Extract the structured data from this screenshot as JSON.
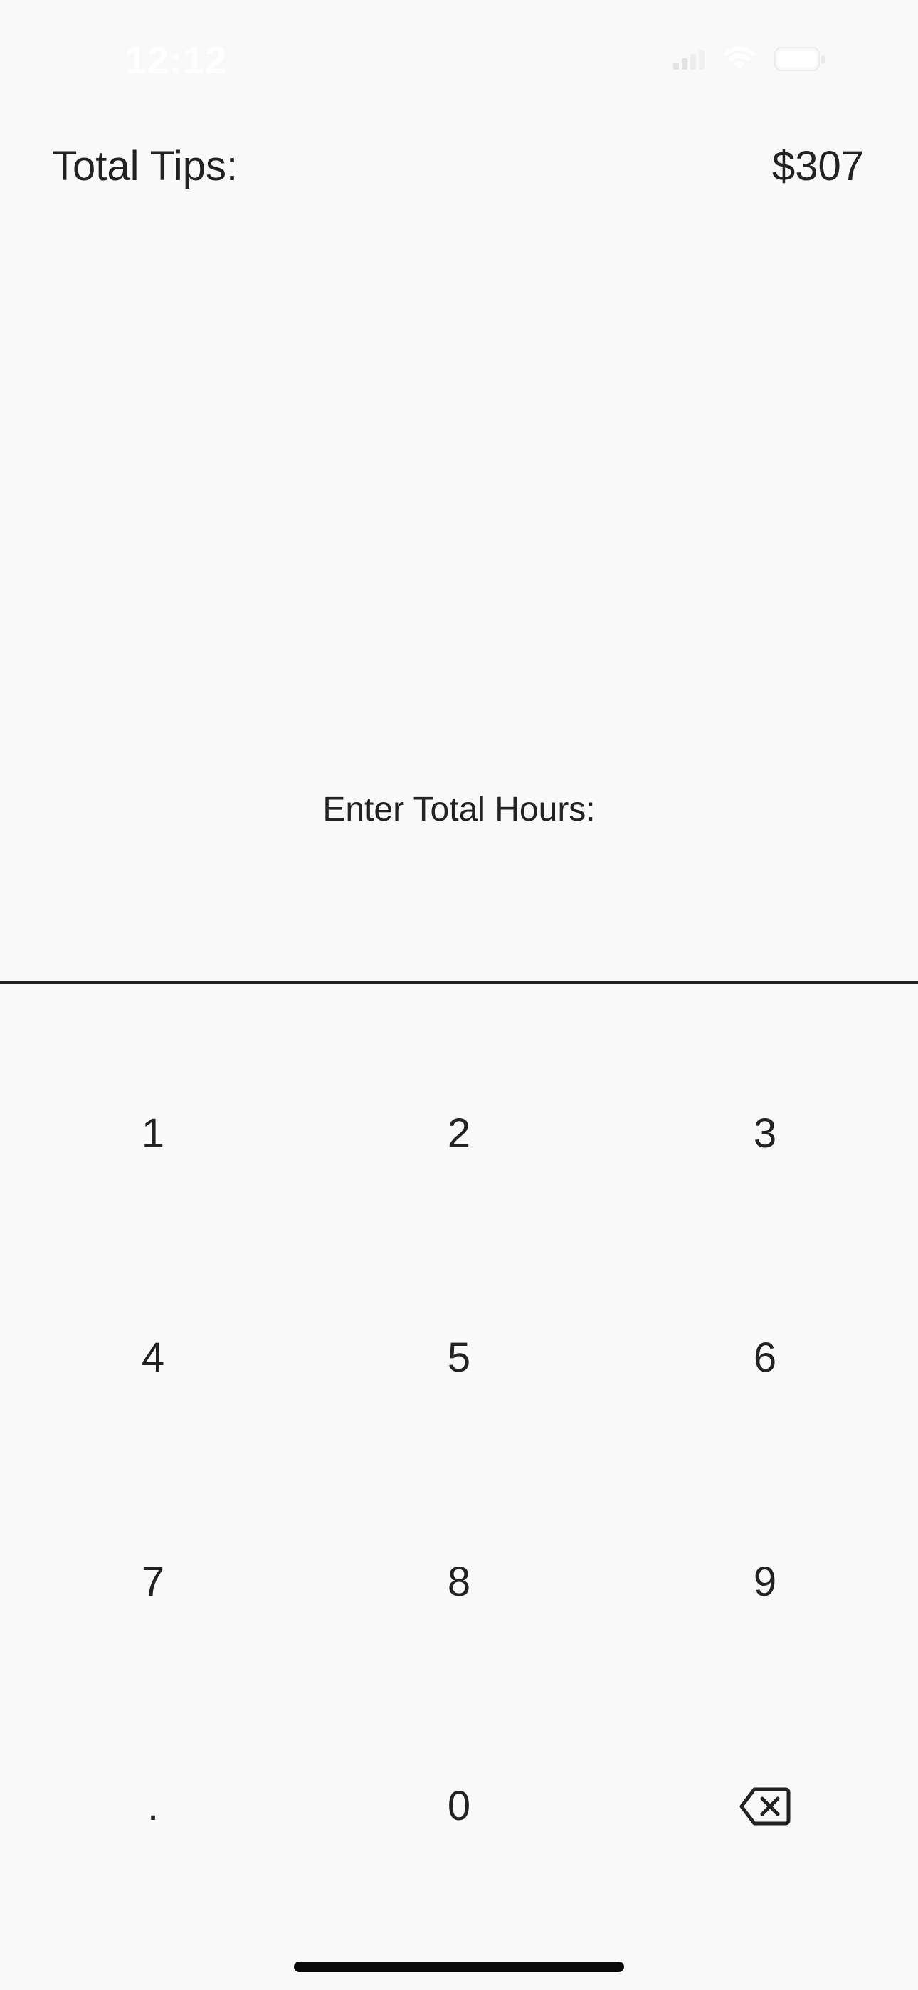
{
  "status_bar": {
    "time": "12:12",
    "signal_icon": "cellular-signal-icon",
    "wifi_icon": "wifi-icon",
    "battery_icon": "battery-icon"
  },
  "summary": {
    "total_tips_label": "Total Tips:",
    "total_tips_value": "$307"
  },
  "hours": {
    "prompt": "Enter Total Hours:",
    "value": "",
    "placeholder": ""
  },
  "keypad": {
    "keys": [
      "1",
      "2",
      "3",
      "4",
      "5",
      "6",
      "7",
      "8",
      "9",
      ".",
      "0"
    ],
    "delete_icon": "backspace-icon"
  },
  "colors": {
    "background": "#f9f9f9",
    "text": "#222222",
    "divider": "#222222"
  }
}
